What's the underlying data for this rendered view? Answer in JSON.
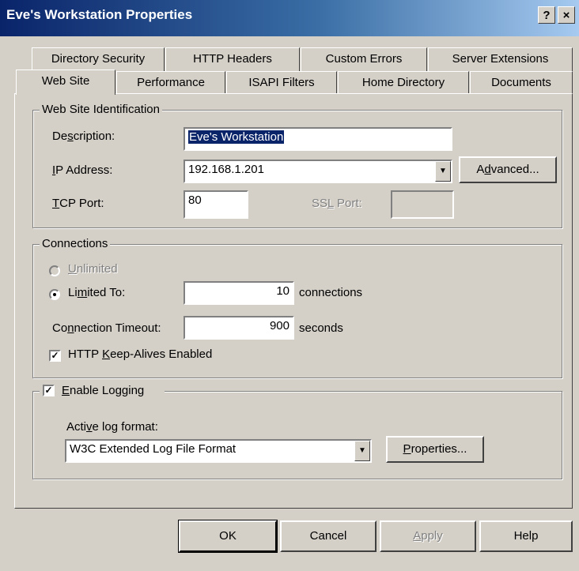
{
  "window": {
    "title": "Eve's Workstation Properties",
    "help_glyph": "?",
    "close_glyph": "×"
  },
  "tabs": {
    "row1": [
      "Directory Security",
      "HTTP Headers",
      "Custom Errors",
      "Server Extensions"
    ],
    "row2": [
      "Web Site",
      "Performance",
      "ISAPI Filters",
      "Home Directory",
      "Documents"
    ],
    "active": "Web Site"
  },
  "identification": {
    "group_label": "Web Site Identification",
    "description_label_pre": "De",
    "description_label_u": "s",
    "description_label_post": "cription:",
    "description_value": "Eve's Workstation",
    "ip_label_u": "I",
    "ip_label_post": "P Address:",
    "ip_value": "192.168.1.201",
    "advanced_pre": "A",
    "advanced_u": "d",
    "advanced_post": "vanced...",
    "tcp_label_u": "T",
    "tcp_label_post": "CP Port:",
    "tcp_value": "80",
    "ssl_label_pre": "SS",
    "ssl_label_u": "L",
    "ssl_label_post": " Port:",
    "ssl_value": ""
  },
  "connections": {
    "group_label": "Connections",
    "unlimited_u": "U",
    "unlimited_post": "nlimited",
    "limited_pre": "Li",
    "limited_u": "m",
    "limited_post": "ited To:",
    "limited_value": "10",
    "limited_unit": "connections",
    "timeout_pre": "Co",
    "timeout_u": "n",
    "timeout_post": "nection Timeout:",
    "timeout_value": "900",
    "timeout_unit": "seconds",
    "keepalive_pre": "HTTP ",
    "keepalive_u": "K",
    "keepalive_post": "eep-Alives Enabled",
    "keepalive_checked": true
  },
  "logging": {
    "enable_u": "E",
    "enable_post": "nable Logging",
    "enable_checked": true,
    "format_label_pre": "Acti",
    "format_label_u": "v",
    "format_label_post": "e log format:",
    "format_value": "W3C Extended Log File Format",
    "properties_u": "P",
    "properties_post": "roperties..."
  },
  "buttons": {
    "ok": "OK",
    "cancel": "Cancel",
    "apply_u": "A",
    "apply_post": "pply",
    "help": "Help"
  }
}
